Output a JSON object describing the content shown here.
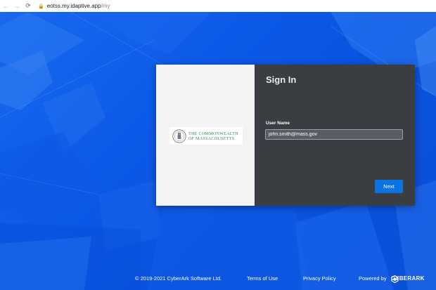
{
  "browser": {
    "back_icon": "←",
    "forward_icon": "→",
    "reload_icon": "⟳",
    "lock_icon": "🔒",
    "url_host": "eotss.my.idaptive.app",
    "url_path": "/my"
  },
  "logo": {
    "line1": "THE COMMONWEALTH",
    "line2": "OF MASSACHUSETTS"
  },
  "signin": {
    "title": "Sign In",
    "username_label": "User Name",
    "username_value": "john.smith@mass.gov",
    "next_label": "Next"
  },
  "footer": {
    "copyright": "© 2019-2021 CyberArk Software Ltd.",
    "terms": "Terms of Use",
    "privacy": "Privacy Policy",
    "powered_by": "Powered by",
    "brand": "CYBERARK"
  },
  "colors": {
    "background": "#0b57e6",
    "panel_dark": "#3a3d42",
    "button": "#0b74e5",
    "logo_text": "#3d8a5a"
  }
}
